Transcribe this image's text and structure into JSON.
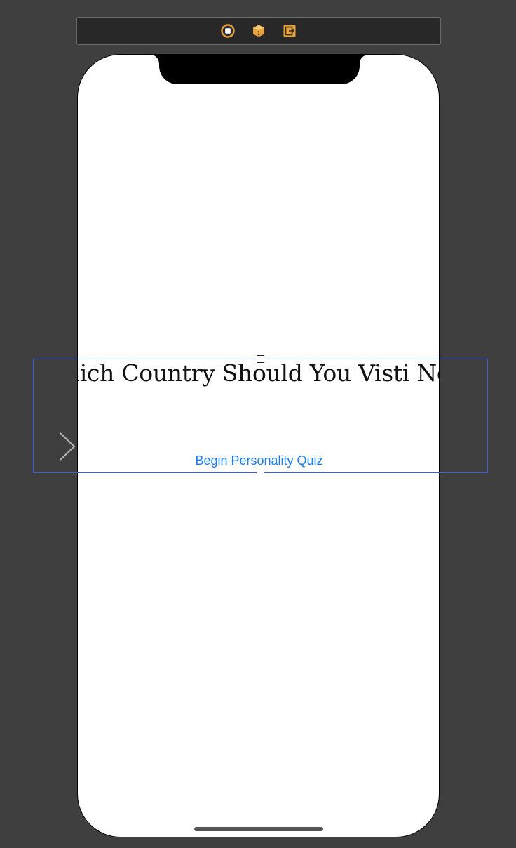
{
  "scene_dock": {
    "icons": [
      "view-controller-icon",
      "first-responder-icon",
      "exit-icon"
    ],
    "accent_color": "#e6a23c"
  },
  "scene": {
    "title_label": "Which Country Should You Visti Next?",
    "begin_button_label": "Begin Personality Quiz",
    "button_color": "#1a7cf0",
    "selection_color": "#3d5ce8"
  }
}
